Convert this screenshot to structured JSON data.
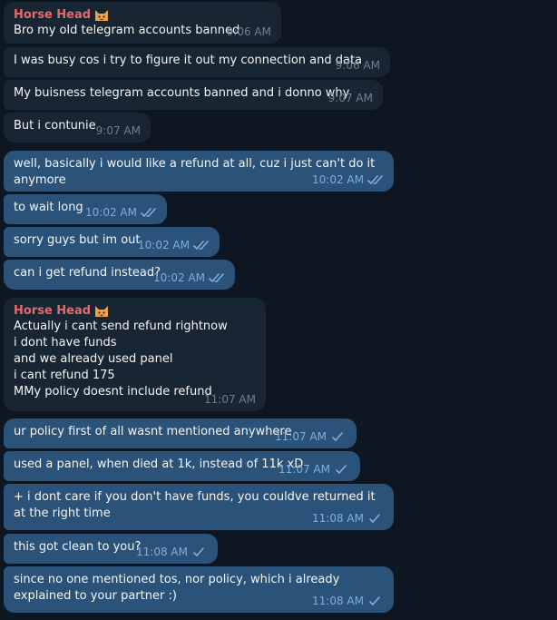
{
  "sender": "Horse Head",
  "messages": [
    {
      "text": "Bro my old telegram accounts banned",
      "time": "9:06 AM"
    },
    {
      "text": "I was busy cos i try to figure it out my connection and data",
      "time": "9:06 AM"
    },
    {
      "text": "My buisness telegram accounts banned and i donno why",
      "time": "9:07 AM"
    },
    {
      "text": "But i contunie",
      "time": "9:07 AM"
    },
    {
      "text": "well, basically i would like a refund at all, cuz i just can't do it anymore",
      "time": "10:02 AM"
    },
    {
      "text": "to wait long",
      "time": "10:02 AM"
    },
    {
      "text": "sorry guys but im out",
      "time": "10:02 AM"
    },
    {
      "text": "can i get refund instead?",
      "time": "10:02 AM"
    },
    {
      "text": "Actually i cant send refund rightnow\ni dont have funds\nand we already used panel\ni cant refund 175\nMMy policy doesnt include refund",
      "time": "11:07 AM"
    },
    {
      "text": "ur policy first of all wasnt mentioned anywhere",
      "time": "11:07 AM"
    },
    {
      "text": "used a panel, when died at 1k, instead of 11k xD",
      "time": "11:07 AM"
    },
    {
      "text": "+ i dont care if you don't have funds, you couldve returned it at the right time",
      "time": "11:08 AM"
    },
    {
      "text": "this got clean to you?",
      "time": "11:08 AM"
    },
    {
      "text": "since no one mentioned tos, nor policy, which i already explained to your partner :)",
      "time": "11:08 AM"
    }
  ],
  "colors": {
    "background": "#0e1621",
    "incoming_bubble": "#182533",
    "outgoing_bubble": "#2b5278",
    "sender_name": "#e06c6c",
    "check": "#7eaedb"
  },
  "icons": {
    "emoji": "cat-emoji-icon",
    "read": "double-check-icon",
    "sent": "single-check-icon"
  }
}
